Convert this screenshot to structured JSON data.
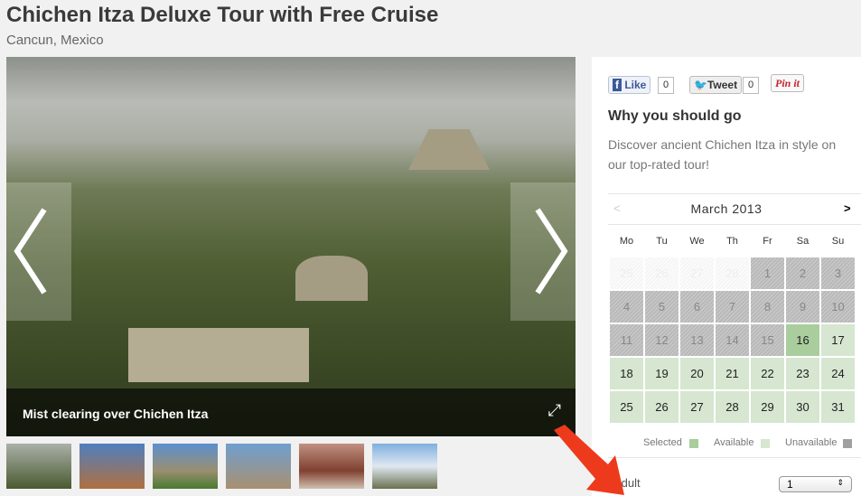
{
  "title": "Chichen Itza Deluxe Tour with Free Cruise",
  "subtitle": "Cancun, Mexico",
  "gallery": {
    "caption": "Mist clearing over Chichen Itza",
    "prev_icon": "chevron-left-icon",
    "next_icon": "chevron-right-icon",
    "expand_icon": "expand-icon",
    "thumbnail_count": 6
  },
  "social": {
    "like": "Like",
    "like_count": "0",
    "tweet": "Tweet",
    "tweet_count": "0",
    "pin": "Pin it"
  },
  "why": {
    "heading": "Why you should go",
    "text": "Discover ancient Chichen Itza in style on our top-rated tour!"
  },
  "calendar": {
    "month": "March 2013",
    "prev": "<",
    "next": ">",
    "weekdays": [
      "Mo",
      "Tu",
      "We",
      "Th",
      "Fr",
      "Sa",
      "Su"
    ],
    "days": [
      [
        {
          "d": "25",
          "s": "prev"
        },
        {
          "d": "26",
          "s": "prev"
        },
        {
          "d": "27",
          "s": "prev"
        },
        {
          "d": "28",
          "s": "prev"
        },
        {
          "d": "1",
          "s": "un"
        },
        {
          "d": "2",
          "s": "un"
        },
        {
          "d": "3",
          "s": "un"
        }
      ],
      [
        {
          "d": "4",
          "s": "un"
        },
        {
          "d": "5",
          "s": "un"
        },
        {
          "d": "6",
          "s": "un"
        },
        {
          "d": "7",
          "s": "un"
        },
        {
          "d": "8",
          "s": "un"
        },
        {
          "d": "9",
          "s": "un"
        },
        {
          "d": "10",
          "s": "un"
        }
      ],
      [
        {
          "d": "11",
          "s": "un"
        },
        {
          "d": "12",
          "s": "un"
        },
        {
          "d": "13",
          "s": "un"
        },
        {
          "d": "14",
          "s": "un"
        },
        {
          "d": "15",
          "s": "un"
        },
        {
          "d": "16",
          "s": "sel"
        },
        {
          "d": "17",
          "s": "av"
        }
      ],
      [
        {
          "d": "18",
          "s": "av"
        },
        {
          "d": "19",
          "s": "av"
        },
        {
          "d": "20",
          "s": "av"
        },
        {
          "d": "21",
          "s": "av"
        },
        {
          "d": "22",
          "s": "av"
        },
        {
          "d": "23",
          "s": "av"
        },
        {
          "d": "24",
          "s": "av"
        }
      ],
      [
        {
          "d": "25",
          "s": "av"
        },
        {
          "d": "26",
          "s": "av"
        },
        {
          "d": "27",
          "s": "av"
        },
        {
          "d": "28",
          "s": "av"
        },
        {
          "d": "29",
          "s": "av"
        },
        {
          "d": "30",
          "s": "av"
        },
        {
          "d": "31",
          "s": "av"
        }
      ]
    ],
    "legend": {
      "selected": "Selected",
      "available": "Available",
      "unavailable": "Unavailable"
    },
    "colors": {
      "selected": "#a9cd9c",
      "available": "#d6e6d0",
      "unavailable": "#a0a0a0"
    }
  },
  "booking": {
    "adult_label": "Adult",
    "adult_value": "1"
  }
}
